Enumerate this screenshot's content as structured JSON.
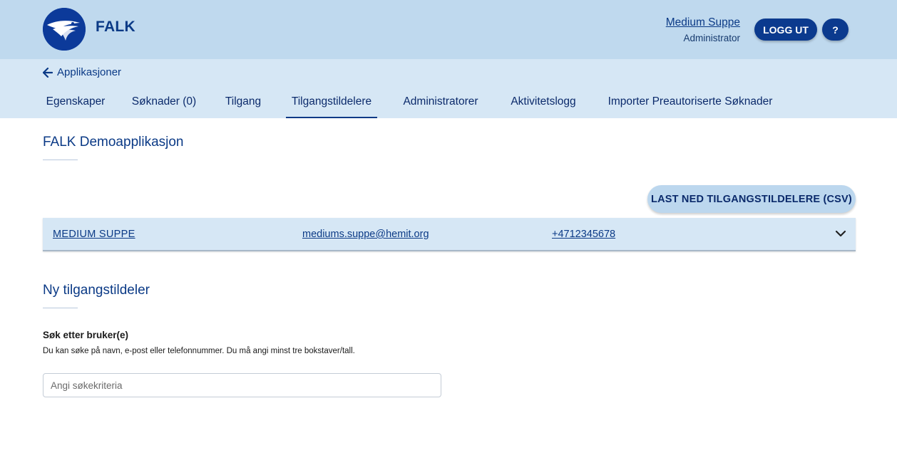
{
  "header": {
    "brand": "FALK",
    "user_name": "Medium Suppe",
    "user_role": "Administrator",
    "logout_label": "LOGG UT",
    "help_label": "?"
  },
  "subheader": {
    "back_label": "Applikasjoner",
    "tabs": [
      {
        "label": "Egenskaper",
        "active": false
      },
      {
        "label": "Søknader (0)",
        "active": false
      },
      {
        "label": "Tilgang",
        "active": false
      },
      {
        "label": "Tilgangstildelere",
        "active": true
      },
      {
        "label": "Administratorer",
        "active": false
      },
      {
        "label": "Aktivitetslogg",
        "active": false
      },
      {
        "label": "Importer Preautoriserte Søknader",
        "active": false
      }
    ]
  },
  "main": {
    "app_title": "FALK Demoapplikasjon",
    "csv_button_label": "LAST NED TILGANGSTILDELERE (CSV)",
    "grantors": [
      {
        "name": "MEDIUM SUPPE",
        "email": "mediums.suppe@hemit.org",
        "phone": "+4712345678"
      }
    ],
    "new_section_title": "Ny tilgangstildeler",
    "search": {
      "label": "Søk etter bruker(e)",
      "help": "Du kan søke på navn, e-post eller telefonnummer. Du må angi minst tre bokstaver/tall.",
      "placeholder": "Angi søkekriteria",
      "value": ""
    }
  },
  "colors": {
    "header_bg": "#bfd9ee",
    "subheader_bg": "#d6e7f5",
    "primary": "#0b3a8e"
  }
}
